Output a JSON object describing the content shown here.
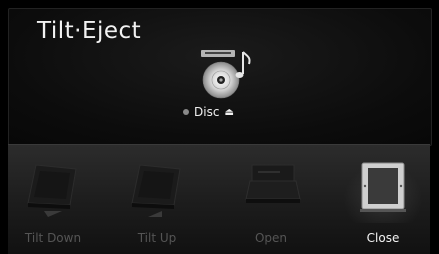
{
  "title": "Tilt·Eject",
  "disc": {
    "label": "Disc",
    "eject_glyph": "⏏",
    "icon": "music-disc-icon",
    "indicator_color": "#8a8a8a"
  },
  "actions": [
    {
      "label": "Tilt Down",
      "icon": "tilt-down-icon",
      "enabled": false
    },
    {
      "label": "Tilt Up",
      "icon": "tilt-up-icon",
      "enabled": false
    },
    {
      "label": "Open",
      "icon": "open-icon",
      "enabled": false
    },
    {
      "label": "Close",
      "icon": "close-icon",
      "enabled": true
    }
  ],
  "colors": {
    "active_text": "#f4f4f4",
    "inactive_text": "#555555",
    "background": "#000000"
  }
}
